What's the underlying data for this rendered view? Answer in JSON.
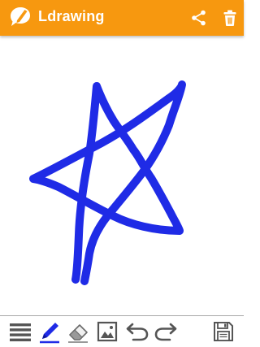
{
  "app": {
    "title": "Ldrawing"
  },
  "header": {
    "background_color": "#f7980f",
    "actions": [
      {
        "name": "share",
        "icon": "share-icon"
      },
      {
        "name": "delete",
        "icon": "trash-icon"
      }
    ]
  },
  "canvas": {
    "background_color": "#ffffff",
    "stroke_color": "#1f2be6",
    "drawing": "star"
  },
  "toolbar": {
    "tools": [
      {
        "name": "menu",
        "icon": "menu-icon"
      },
      {
        "name": "pen",
        "icon": "pen-icon",
        "selected": true,
        "color": "#1f2be6"
      },
      {
        "name": "eraser",
        "icon": "eraser-icon"
      },
      {
        "name": "image",
        "icon": "image-icon"
      },
      {
        "name": "undo",
        "icon": "undo-icon"
      },
      {
        "name": "redo",
        "icon": "redo-icon"
      },
      {
        "name": "save",
        "icon": "save-icon"
      }
    ]
  }
}
